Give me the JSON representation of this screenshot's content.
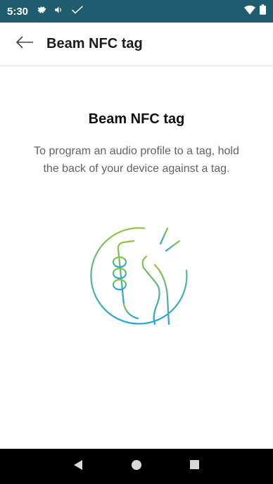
{
  "status_bar": {
    "time": "5:30",
    "icons": [
      "gear-icon",
      "volume-icon",
      "check-icon"
    ],
    "right_icons": [
      "wifi-icon",
      "battery-icon"
    ],
    "background": "#1f5c6e"
  },
  "app_bar": {
    "back_icon": "back-arrow-icon",
    "title": "Beam NFC tag"
  },
  "content": {
    "heading": "Beam NFC tag",
    "description": "To program an audio profile to a tag, hold the back of your device against a tag.",
    "illustration": "nfc-hand-phone-icon",
    "accent_colors": [
      "#8cc63f",
      "#29a3d6"
    ]
  },
  "nav_bar": {
    "back": "nav-back-icon",
    "home": "nav-home-icon",
    "recents": "nav-recents-icon"
  }
}
